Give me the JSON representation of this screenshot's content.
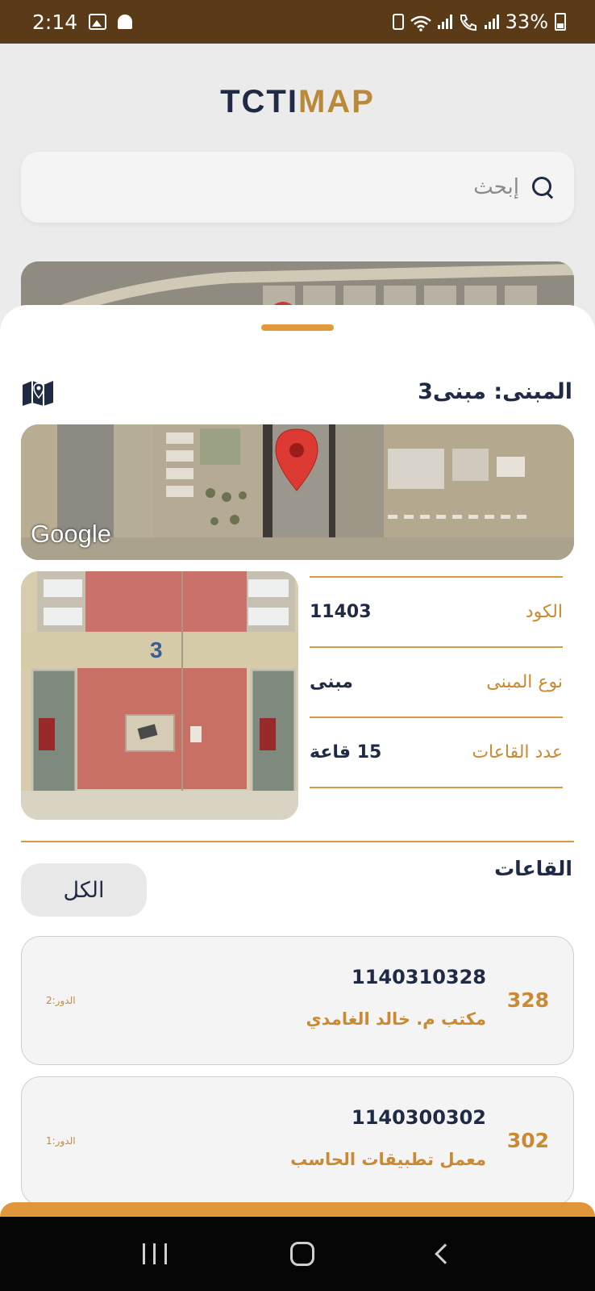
{
  "status_bar": {
    "time": "2:14",
    "battery": "33%"
  },
  "app": {
    "logo_part1": "TCTI",
    "logo_part2": "MAP",
    "search_placeholder": "إبحث"
  },
  "building": {
    "title": "المبنى: مبنى3",
    "map_attribution": "Google",
    "photo_number": "3",
    "info": [
      {
        "label": "الكود",
        "value": "11403"
      },
      {
        "label": "نوع المبنى",
        "value": "مبنى"
      },
      {
        "label": "عدد القاعات",
        "value": "15 قاعة"
      }
    ]
  },
  "rooms": {
    "title": "القاعات",
    "filter_label": "الكل",
    "items": [
      {
        "number": "328",
        "code": "1140310328",
        "name": "مكتب م. خالد الغامدي",
        "floor": "الدور:2"
      },
      {
        "number": "302",
        "code": "1140300302",
        "name": "معمل تطبيقات الحاسب",
        "floor": "الدور:1"
      }
    ]
  },
  "colors": {
    "accent": "#e0963a",
    "navy": "#1f2a44",
    "status_bar": "#5b3a17"
  }
}
